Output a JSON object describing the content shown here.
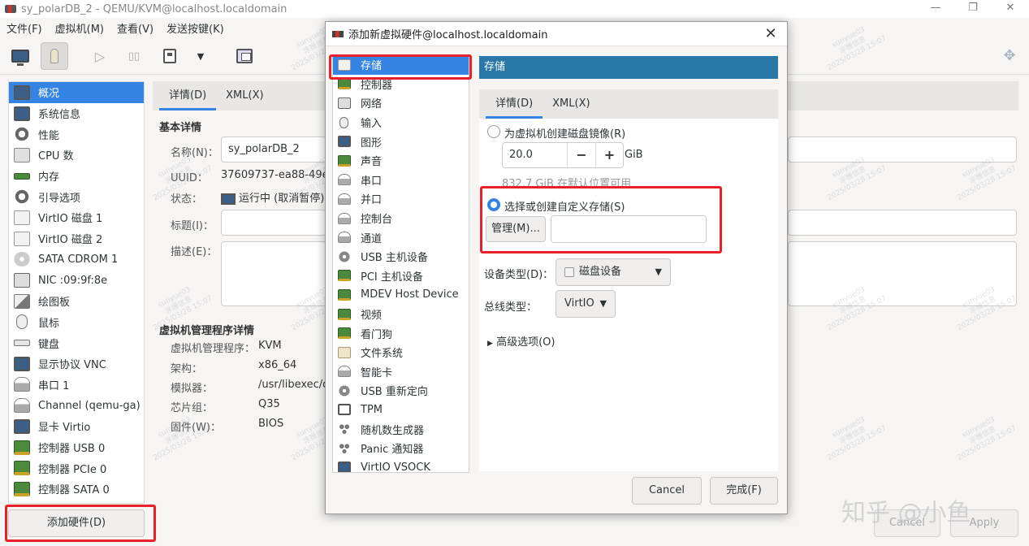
{
  "window": {
    "title": "sy_polarDB_2 - QEMU/KVM@localhost.localdomain",
    "controls": [
      "—",
      "❐",
      "✕"
    ]
  },
  "menu": [
    "文件(F)",
    "虚拟机(M)",
    "查看(V)",
    "发送按键(K)"
  ],
  "sidebar": {
    "items": [
      {
        "label": "概况",
        "icon": "monitor-icon"
      },
      {
        "label": "系统信息",
        "icon": "monitor-icon"
      },
      {
        "label": "性能",
        "icon": "gear-icon"
      },
      {
        "label": "CPU 数",
        "icon": "chip-icon"
      },
      {
        "label": "内存",
        "icon": "ram-icon"
      },
      {
        "label": "引导选项",
        "icon": "gear-icon"
      },
      {
        "label": "VirtIO 磁盘 1",
        "icon": "disk-icon"
      },
      {
        "label": "VirtIO 磁盘 2",
        "icon": "disk-icon"
      },
      {
        "label": "SATA CDROM 1",
        "icon": "cdrom-icon"
      },
      {
        "label": "NIC :09:9f:8e",
        "icon": "nic-icon"
      },
      {
        "label": "绘图板",
        "icon": "tablet-icon"
      },
      {
        "label": "鼠标",
        "icon": "mouse-icon"
      },
      {
        "label": "键盘",
        "icon": "keyboard-icon"
      },
      {
        "label": "显示协议 VNC",
        "icon": "monitor-icon"
      },
      {
        "label": "串口 1",
        "icon": "serial-icon"
      },
      {
        "label": "Channel (qemu-ga)",
        "icon": "serial-icon"
      },
      {
        "label": "显卡 Virtio",
        "icon": "monitor-icon"
      },
      {
        "label": "控制器 USB 0",
        "icon": "card-icon"
      },
      {
        "label": "控制器 PCIe 0",
        "icon": "card-icon"
      },
      {
        "label": "控制器 SATA 0",
        "icon": "card-icon"
      }
    ],
    "add_hardware": "添加硬件(D)"
  },
  "main": {
    "tabs": [
      "详情(D)",
      "XML(X)"
    ],
    "basic_header": "基本详情",
    "name_label": "名称(N)：",
    "name_value": "sy_polarDB_2",
    "uuid_label": "UUID：",
    "uuid_value": "37609737-ea88-49e6-a",
    "status_label": "状态：",
    "status_value": "运行中 (取消暂停)",
    "title_label": "标题(I)：",
    "desc_label": "描述(E)：",
    "hv_header": "虚拟机管理程序详情",
    "hv_label": "虚拟机管理程序：",
    "hv_value": "KVM",
    "arch_label": "架构：",
    "arch_value": "x86_64",
    "emu_label": "模拟器：",
    "emu_value": "/usr/libexec/qe",
    "chipset_label": "芯片组：",
    "chipset_value": "Q35",
    "firmware_label": "固件(W)：",
    "firmware_value": "BIOS",
    "cancel": "Cancel",
    "apply": "Apply"
  },
  "dialog": {
    "title": "添加新虚拟硬件@localhost.localdomain",
    "close": "✕",
    "hw_list": [
      {
        "label": "存储",
        "icon": "disk-icon"
      },
      {
        "label": "控制器",
        "icon": "card-icon"
      },
      {
        "label": "网络",
        "icon": "nic-icon"
      },
      {
        "label": "输入",
        "icon": "mouse-icon"
      },
      {
        "label": "图形",
        "icon": "monitor-icon"
      },
      {
        "label": "声音",
        "icon": "card-icon"
      },
      {
        "label": "串口",
        "icon": "serial-icon"
      },
      {
        "label": "并口",
        "icon": "serial-icon"
      },
      {
        "label": "控制台",
        "icon": "serial-icon"
      },
      {
        "label": "通道",
        "icon": "serial-icon"
      },
      {
        "label": "USB 主机设备",
        "icon": "usb-icon"
      },
      {
        "label": "PCI 主机设备",
        "icon": "card-icon"
      },
      {
        "label": "MDEV Host Device",
        "icon": "card-icon"
      },
      {
        "label": "视频",
        "icon": "card-icon"
      },
      {
        "label": "看门狗",
        "icon": "card-icon"
      },
      {
        "label": "文件系统",
        "icon": "folder-icon"
      },
      {
        "label": "智能卡",
        "icon": "serial-icon"
      },
      {
        "label": "USB 重新定向",
        "icon": "usb-icon"
      },
      {
        "label": "TPM",
        "icon": "chip-icon"
      },
      {
        "label": "随机数生成器",
        "icon": "dots-icon"
      },
      {
        "label": "Panic 通知器",
        "icon": "dots-icon"
      },
      {
        "label": "VirtIO VSOCK",
        "icon": "monitor-icon"
      }
    ],
    "header": "存储",
    "tabs": [
      "详情(D)",
      "XML(X)"
    ],
    "create_image_label": "为虚拟机创建磁盘镜像(R)",
    "size_value": "20.0",
    "size_unit": "GiB",
    "minus": "−",
    "plus": "+",
    "available_text": "832.7 GiB 在默认位置可用",
    "custom_storage_label": "选择或创建自定义存储(S)",
    "manage_button": "管理(M)...",
    "device_type_label": "设备类型(D)：",
    "device_type_value": "磁盘设备",
    "bus_type_label": "总线类型：",
    "bus_type_value": "VirtIO",
    "advanced_label": "高级选项(O)",
    "cancel": "Cancel",
    "finish": "完成(F)"
  },
  "watermark": {
    "lines": [
      "sunyue03",
      "涂姗信息",
      "2025/03/28 15:07"
    ],
    "brand": "知乎 @小鱼"
  },
  "colors": {
    "accent": "#3584e4",
    "header": "#2b78a8",
    "highlight_box": "#e8202a"
  }
}
